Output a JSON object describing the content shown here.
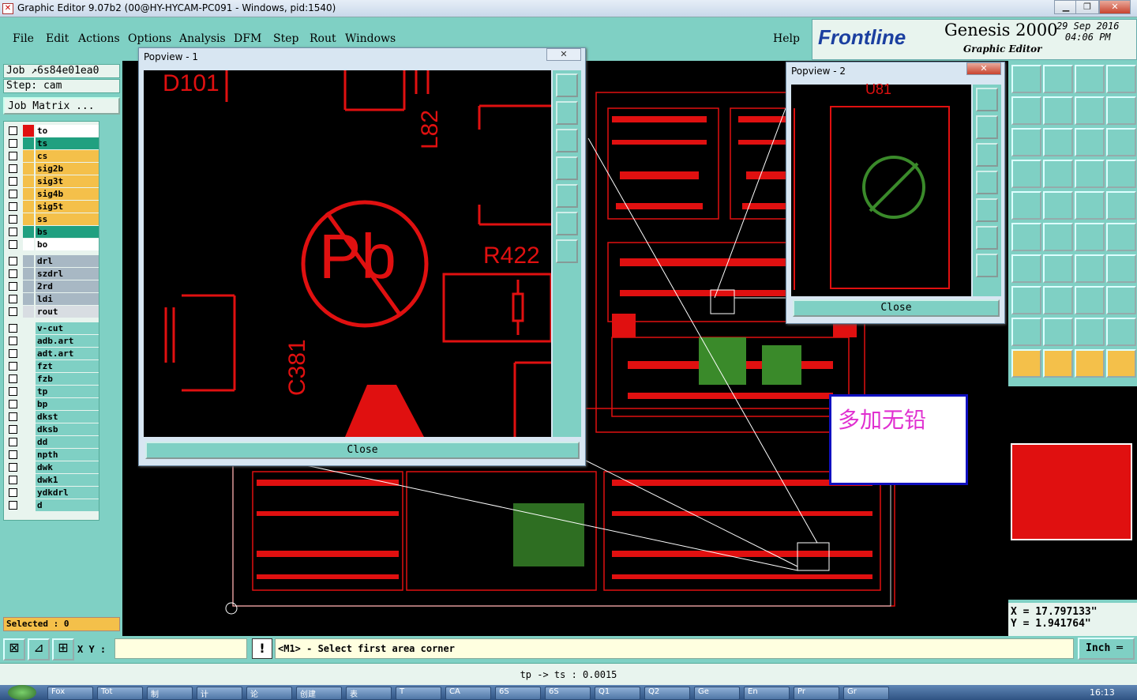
{
  "window": {
    "title": "Graphic Editor 9.07b2 (00@HY-HYCAM-PC091 - Windows, pid:1540)"
  },
  "menu": [
    "File",
    "Edit",
    "Actions",
    "Options",
    "Analysis",
    "DFM",
    "Step",
    "Rout",
    "Windows"
  ],
  "help": "Help",
  "brand": {
    "logo": "Frontline",
    "product": "Genesis 2000",
    "subtitle": "Graphic Editor",
    "date": "29 Sep 2016",
    "time": "04:06 PM"
  },
  "job": {
    "label": "Job",
    "name": "6s84e01ea0",
    "step": "Step: cam",
    "matrix": "Job Matrix ..."
  },
  "layers": [
    {
      "name": "to",
      "color": "#ffffff",
      "sw": "#e01010"
    },
    {
      "name": "ts",
      "color": "#20a080",
      "sw": "#20a080"
    },
    {
      "name": "cs",
      "color": "#f4c04a",
      "sw": "#f4c04a"
    },
    {
      "name": "sig2b",
      "color": "#f4c04a",
      "sw": "#f4c04a"
    },
    {
      "name": "sig3t",
      "color": "#f4c04a",
      "sw": "#f4c04a"
    },
    {
      "name": "sig4b",
      "color": "#f4c04a",
      "sw": "#f4c04a"
    },
    {
      "name": "sig5t",
      "color": "#f4c04a",
      "sw": "#f4c04a"
    },
    {
      "name": "ss",
      "color": "#f4c04a",
      "sw": "#f4c04a"
    },
    {
      "name": "bs",
      "color": "#20a080",
      "sw": "#20a080"
    },
    {
      "name": "bo",
      "color": "#ffffff",
      "sw": "#ffffff"
    },
    {
      "name": "drl",
      "color": "#a8b8c4",
      "sw": "#a8b8c4"
    },
    {
      "name": "szdrl",
      "color": "#a8b8c4",
      "sw": "#a8b8c4"
    },
    {
      "name": "2rd",
      "color": "#a8b8c4",
      "sw": "#a8b8c4"
    },
    {
      "name": "ldi",
      "color": "#a8b8c4",
      "sw": "#a8b8c4"
    },
    {
      "name": "rout",
      "color": "#d8dde2",
      "sw": "#d8dde2"
    },
    {
      "name": "v-cut",
      "color": "#7fd0c4",
      "sw": "#7fd0c4"
    },
    {
      "name": "adb.art",
      "color": "#7fd0c4",
      "sw": "#7fd0c4"
    },
    {
      "name": "adt.art",
      "color": "#7fd0c4",
      "sw": "#7fd0c4"
    },
    {
      "name": "fzt",
      "color": "#7fd0c4",
      "sw": "#7fd0c4"
    },
    {
      "name": "fzb",
      "color": "#7fd0c4",
      "sw": "#7fd0c4"
    },
    {
      "name": "tp",
      "color": "#7fd0c4",
      "sw": "#7fd0c4"
    },
    {
      "name": "bp",
      "color": "#7fd0c4",
      "sw": "#7fd0c4"
    },
    {
      "name": "dkst",
      "color": "#7fd0c4",
      "sw": "#7fd0c4"
    },
    {
      "name": "dksb",
      "color": "#7fd0c4",
      "sw": "#7fd0c4"
    },
    {
      "name": "dd",
      "color": "#7fd0c4",
      "sw": "#7fd0c4"
    },
    {
      "name": "npth",
      "color": "#7fd0c4",
      "sw": "#7fd0c4"
    },
    {
      "name": "dwk",
      "color": "#7fd0c4",
      "sw": "#7fd0c4"
    },
    {
      "name": "dwk1",
      "color": "#7fd0c4",
      "sw": "#7fd0c4"
    },
    {
      "name": "ydkdrl",
      "color": "#7fd0c4",
      "sw": "#7fd0c4"
    },
    {
      "name": "d",
      "color": "#7fd0c4",
      "sw": "#7fd0c4"
    }
  ],
  "selected": "Selected : 0",
  "popup1": {
    "title": "Popview - 1",
    "close": "Close",
    "labels": {
      "d101": "D101",
      "l82": "L82",
      "r422": "R422",
      "c381": "C381",
      "pb": "Pb"
    }
  },
  "popup2": {
    "title": "Popview - 2",
    "close": "Close",
    "label": "U81"
  },
  "note": "多加无铅",
  "coords": {
    "x": "X = 17.797133\"",
    "y": "Y = 1.941764\""
  },
  "xy_label": "X Y :",
  "xy_value": "",
  "prompt": "<M1> - Select first area corner",
  "units": "Inch",
  "status": "tp -> ts : 0.0015",
  "taskbar": [
    "Fox",
    "Tot",
    "制",
    "计",
    "论",
    "创建",
    "表",
    "T",
    "CA",
    "6S",
    "6S",
    "Q1",
    "Q2",
    "Ge",
    "En",
    "Pr",
    "Gr"
  ],
  "clock": "16:13"
}
